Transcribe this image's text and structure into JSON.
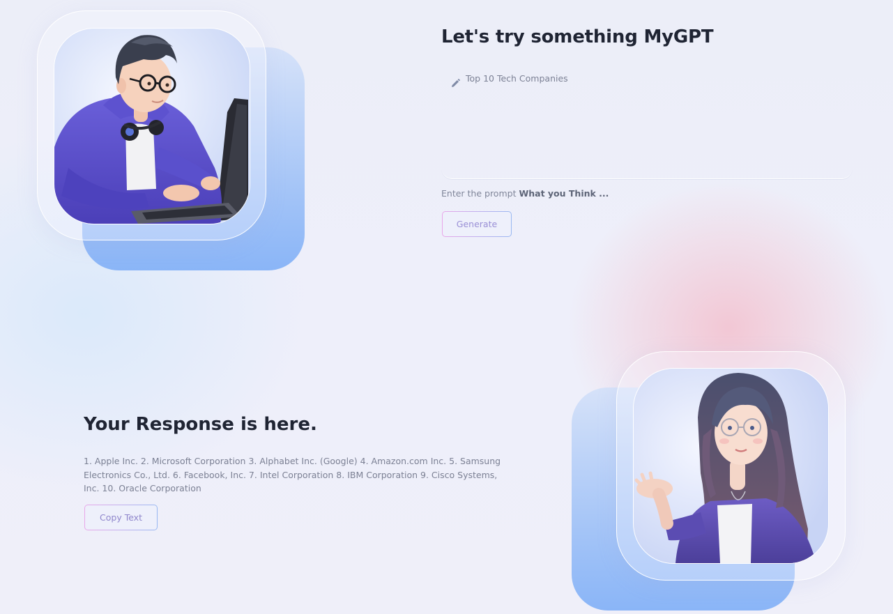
{
  "prompt_section": {
    "title": "Let's try something MyGPT",
    "prompt_value": "Top 10 Tech Companies",
    "pencil_icon": "pencil-icon",
    "hint_prefix": "Enter the prompt ",
    "hint_bold": "What you Think ...",
    "generate_label": "Generate"
  },
  "response_section": {
    "title": "Your Response is here.",
    "text": "1. Apple Inc. 2. Microsoft Corporation 3. Alphabet Inc. (Google) 4. Amazon.com Inc. 5. Samsung Electronics Co., Ltd. 6. Facebook, Inc. 7. Intel Corporation 8. IBM Corporation 9. Cisco Systems, Inc. 10. Oracle Corporation",
    "copy_label": "Copy Text"
  },
  "colors": {
    "heading": "#1f2433",
    "body_text": "#7b8094",
    "button_gradient_start": "#e9a6e9",
    "button_gradient_end": "#98b7f2",
    "card_blue": "#8ab5f7",
    "glow_pink": "#f4bac8"
  }
}
